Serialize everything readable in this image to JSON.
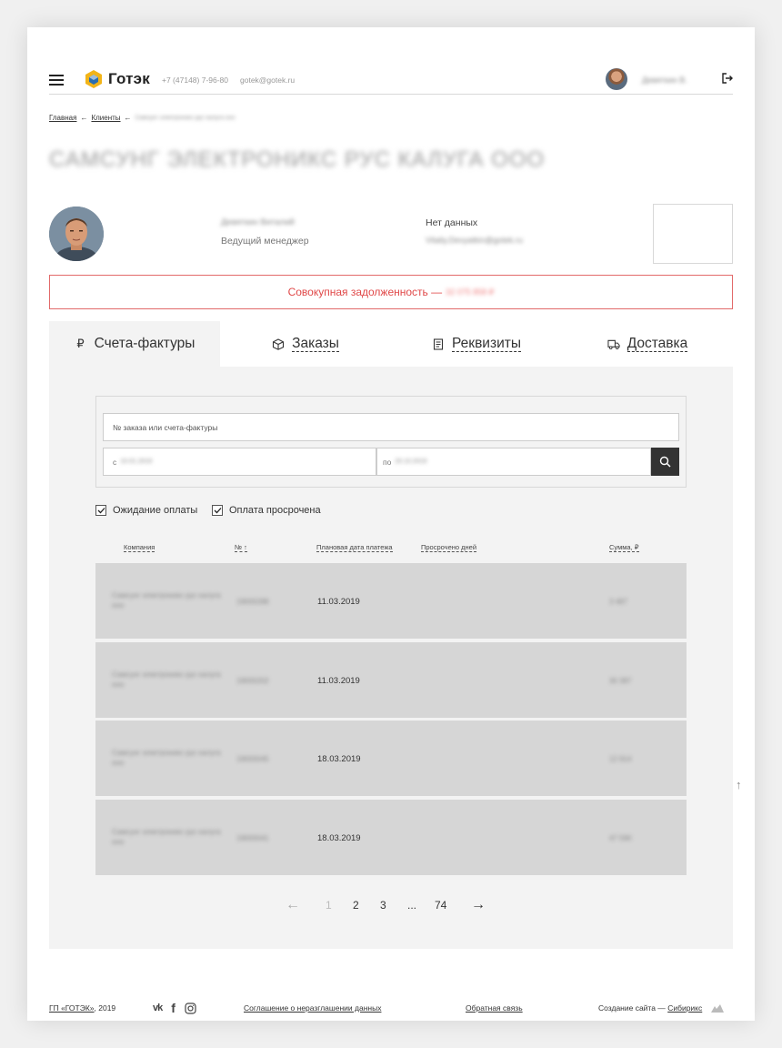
{
  "header": {
    "logo_text": "Готэк",
    "phone": "+7 (47148) 7-96-80",
    "email": "gotek@gotek.ru",
    "user_name": "Девяткин В."
  },
  "breadcrumb": {
    "home": "Главная",
    "clients": "Клиенты",
    "separator": "←",
    "current": "Самсунг электроникс рус калуга ооо"
  },
  "page_title": "Самсунг электроникс рус калуга ооо",
  "manager": {
    "name": "Девяткин Виталий",
    "role": "Ведущий менеджер",
    "contact_label": "Нет данных",
    "contact_email": "Vitaliy.Devyatkin@gotek.ru"
  },
  "debt": {
    "label": "Совокупная задолженность —",
    "amount": "32 075 858 ₽"
  },
  "tabs": [
    {
      "label": "Счета-фактуры",
      "icon": "₽"
    },
    {
      "label": "Заказы",
      "icon": "box-icon"
    },
    {
      "label": "Реквизиты",
      "icon": "document-icon"
    },
    {
      "label": "Доставка",
      "icon": "truck-icon"
    }
  ],
  "filters": {
    "order_placeholder": "№ заказа или счета-фактуры",
    "from_prefix": "с",
    "from_value": "10.01.2019",
    "to_prefix": "по",
    "to_value": "20.10.2019",
    "checkbox_waiting": "Ожидание оплаты",
    "checkbox_overdue": "Оплата просрочена"
  },
  "table": {
    "columns": [
      "Компания",
      "№ ↑",
      "Плановая дата платежа",
      "Просрочено дней",
      "Сумма, ₽"
    ],
    "rows": [
      {
        "company": "Самсунг электроникс рус калуга ооо",
        "number": "19000288",
        "date": "11.03.2019",
        "overdue": "",
        "sum": "3 487"
      },
      {
        "company": "Самсунг электроникс рус калуга ооо",
        "number": "19000202",
        "date": "11.03.2019",
        "overdue": "",
        "sum": "30 387"
      },
      {
        "company": "Самсунг электроникс рус калуга ооо",
        "number": "19000045",
        "date": "18.03.2019",
        "overdue": "",
        "sum": "12 914"
      },
      {
        "company": "Самсунг электроникс рус калуга ооо",
        "number": "19000041",
        "date": "18.03.2019",
        "overdue": "",
        "sum": "47 590"
      }
    ]
  },
  "pagination": {
    "prev": "←",
    "current": "1",
    "pages": [
      "2",
      "3"
    ],
    "dots": "...",
    "last": "74",
    "next": "→"
  },
  "footer": {
    "copyright_link": "ГП «ГОТЭК»",
    "copyright_year": ", 2019",
    "nda": "Соглашение о неразглашении данных",
    "feedback": "Обратная связь",
    "credits_prefix": "Создание сайта —",
    "credits_link": "Сибирикс"
  },
  "colors": {
    "accent_red": "#e04848",
    "logo_yellow": "#f2b418",
    "panel_bg": "#f3f3f3"
  }
}
